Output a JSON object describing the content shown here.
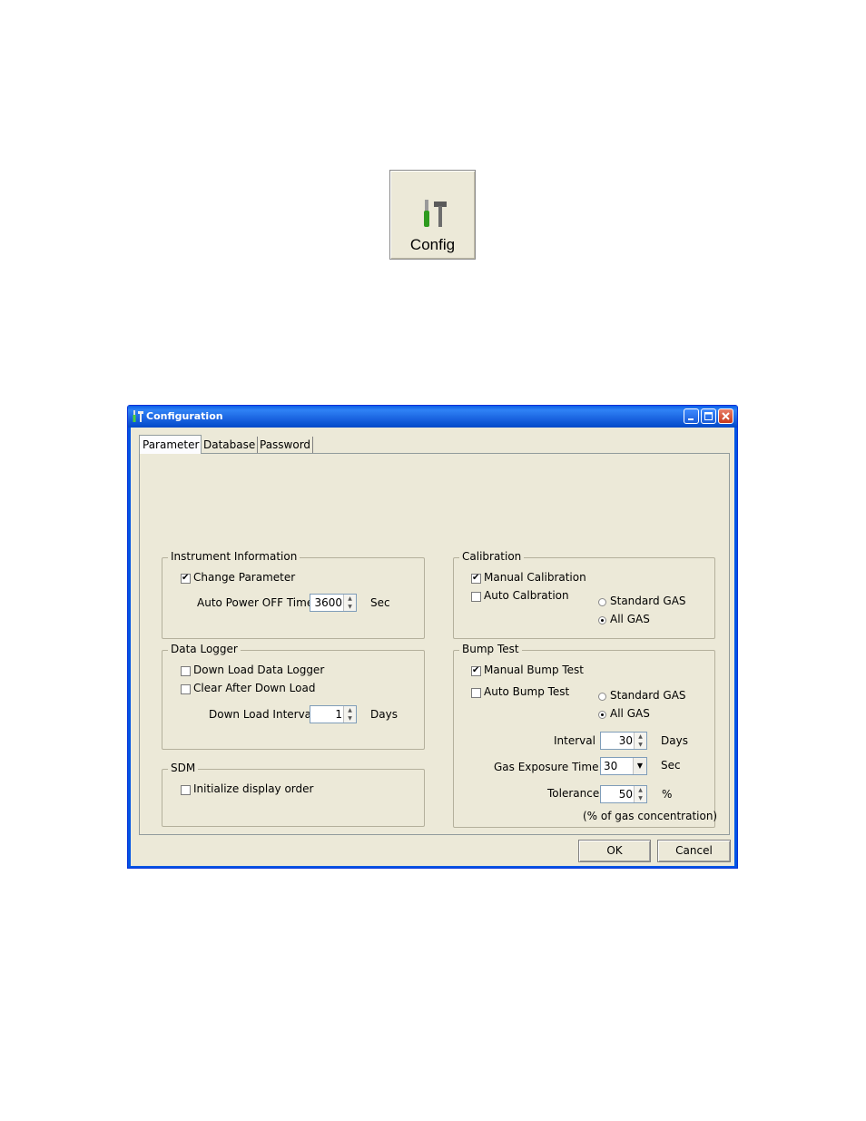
{
  "toolbar": {
    "config_label": "Config",
    "config_icon": "tools-icon"
  },
  "window": {
    "title": "Configuration",
    "title_bar_color": "#0054e3",
    "tabs": [
      "Parameter",
      "Database",
      "Password"
    ],
    "active_tab": "Parameter"
  },
  "instrument": {
    "legend": "Instrument Information",
    "change_parameter_label": "Change Parameter",
    "change_parameter_checked": true,
    "auto_power_label": "Auto Power OFF Time",
    "auto_power_value": "3600",
    "auto_power_unit": "Sec"
  },
  "data_logger": {
    "legend": "Data Logger",
    "download_label": "Down Load Data Logger",
    "download_checked": false,
    "clear_label": "Clear After Down Load",
    "clear_checked": false,
    "interval_label": "Down Load Interval",
    "interval_value": "1",
    "interval_unit": "Days"
  },
  "sdm": {
    "legend": "SDM",
    "init_label": "Initialize display order",
    "init_checked": false
  },
  "calibration": {
    "legend": "Calibration",
    "manual_label": "Manual Calibration",
    "manual_checked": true,
    "auto_label": "Auto Calbration",
    "auto_checked": false,
    "standard_gas_label": "Standard GAS",
    "all_gas_label": "All GAS",
    "selected_gas": "All GAS"
  },
  "bump_test": {
    "legend": "Bump Test",
    "manual_label": "Manual Bump Test",
    "manual_checked": true,
    "auto_label": "Auto Bump Test",
    "auto_checked": false,
    "standard_gas_label": "Standard GAS",
    "all_gas_label": "All GAS",
    "selected_gas": "All GAS",
    "interval_label": "Interval",
    "interval_value": "30",
    "interval_unit": "Days",
    "exposure_label": "Gas Exposure Time",
    "exposure_value": "30",
    "exposure_unit": "Sec",
    "tolerance_label": "Tolerance",
    "tolerance_value": "50",
    "tolerance_unit": "%",
    "tolerance_note": "(% of gas concentration)"
  },
  "buttons": {
    "ok": "OK",
    "cancel": "Cancel"
  }
}
